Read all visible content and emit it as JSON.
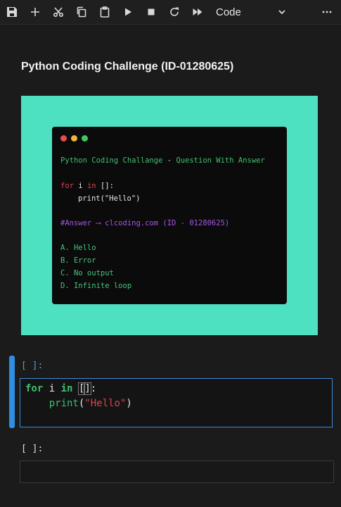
{
  "toolbar": {
    "buttons": [
      {
        "name": "save",
        "icon": "save-icon"
      },
      {
        "name": "insert-cell",
        "icon": "plus-icon"
      },
      {
        "name": "cut",
        "icon": "scissors-icon"
      },
      {
        "name": "copy",
        "icon": "copy-icon"
      },
      {
        "name": "paste",
        "icon": "clipboard-icon"
      },
      {
        "name": "run",
        "icon": "play-icon"
      },
      {
        "name": "interrupt",
        "icon": "stop-icon"
      },
      {
        "name": "restart",
        "icon": "restart-icon"
      },
      {
        "name": "run-all",
        "icon": "fast-forward-icon"
      }
    ],
    "cell_type": "Code",
    "more_icon": "more-horizontal-icon"
  },
  "markdown": {
    "title": "Python Coding Challenge (ID-01280625)"
  },
  "banner": {
    "background": "#4ee1c1",
    "card": {
      "dots": [
        "#e94c4c",
        "#f0b43a",
        "#3ec95a"
      ],
      "header_left": "Python Coding Challange",
      "header_sep": "-",
      "header_right": "Question With Answer",
      "code_kw": "for",
      "code_var": "i",
      "code_in": "in",
      "code_rest": "[]:",
      "code_body": "print(\"Hello\")",
      "answer": "#Answer ⟶ clcoding.com (ID - 01280625)",
      "options": [
        "A. Hello",
        "B. Error",
        "C. No output",
        "D. Infinite loop"
      ]
    }
  },
  "cells": [
    {
      "prompt": "[ ]:",
      "line1": {
        "kw1": "for",
        "var": "i",
        "kw2": "in",
        "bracket_open": "[",
        "bracket_close": "]",
        "colon": ":"
      },
      "line2": {
        "indent": "    ",
        "func": "print",
        "paren_open": "(",
        "string": "\"Hello\"",
        "paren_close": ")"
      }
    },
    {
      "prompt": "[ ]:"
    }
  ]
}
